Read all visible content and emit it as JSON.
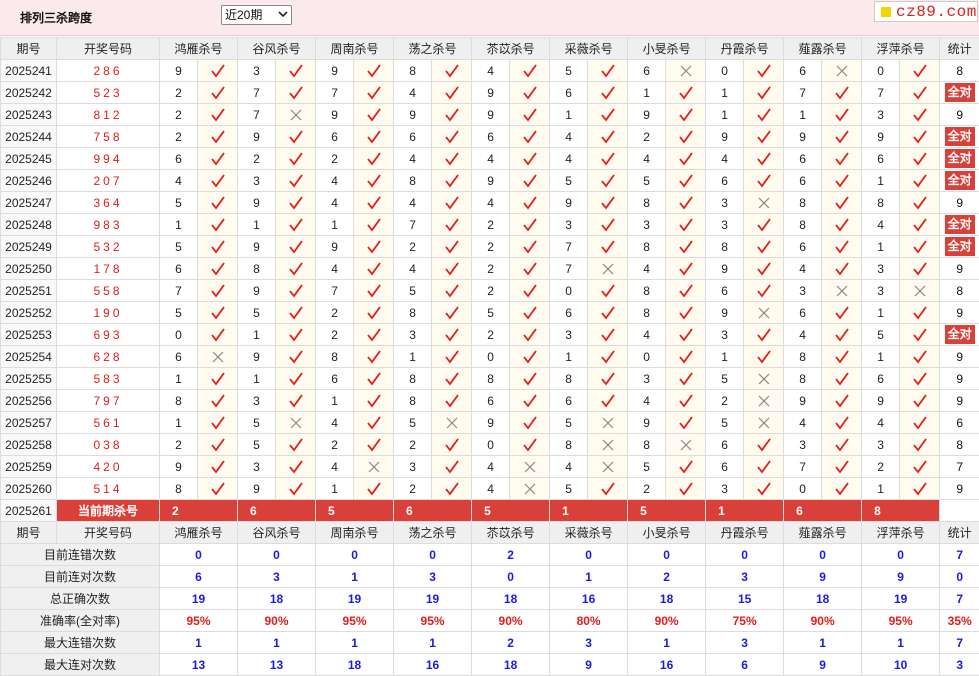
{
  "title": "排列三杀跨度",
  "period_select": {
    "value": "近20期"
  },
  "logo": {
    "text": "cz89.com"
  },
  "headers": {
    "period": "期号",
    "code": "开奖号码",
    "experts": [
      "鸿雁杀号",
      "谷风杀号",
      "周南杀号",
      "荡之杀号",
      "苶苡杀号",
      "采薇杀号",
      "小旻杀号",
      "丹霞杀号",
      "薤露杀号",
      "浮萍杀号"
    ],
    "stat": "统计"
  },
  "rows": [
    {
      "p": "2025241",
      "c": "286",
      "k": [
        "9",
        "3",
        "9",
        "8",
        "4",
        "5",
        "6",
        "0",
        "6",
        "0"
      ],
      "m": [
        1,
        1,
        1,
        1,
        1,
        1,
        0,
        1,
        0,
        1
      ],
      "s": "8"
    },
    {
      "p": "2025242",
      "c": "523",
      "k": [
        "2",
        "7",
        "7",
        "4",
        "9",
        "6",
        "1",
        "1",
        "7",
        "7"
      ],
      "m": [
        1,
        1,
        1,
        1,
        1,
        1,
        1,
        1,
        1,
        1
      ],
      "s": "全对"
    },
    {
      "p": "2025243",
      "c": "812",
      "k": [
        "2",
        "7",
        "9",
        "9",
        "9",
        "1",
        "9",
        "1",
        "1",
        "3"
      ],
      "m": [
        1,
        0,
        1,
        1,
        1,
        1,
        1,
        1,
        1,
        1
      ],
      "s": "9"
    },
    {
      "p": "2025244",
      "c": "758",
      "k": [
        "2",
        "9",
        "6",
        "6",
        "6",
        "4",
        "2",
        "9",
        "9",
        "9"
      ],
      "m": [
        1,
        1,
        1,
        1,
        1,
        1,
        1,
        1,
        1,
        1
      ],
      "s": "全对"
    },
    {
      "p": "2025245",
      "c": "994",
      "k": [
        "6",
        "2",
        "2",
        "4",
        "4",
        "4",
        "4",
        "4",
        "6",
        "6"
      ],
      "m": [
        1,
        1,
        1,
        1,
        1,
        1,
        1,
        1,
        1,
        1
      ],
      "s": "全对"
    },
    {
      "p": "2025246",
      "c": "207",
      "k": [
        "4",
        "3",
        "4",
        "8",
        "9",
        "5",
        "5",
        "6",
        "6",
        "1"
      ],
      "m": [
        1,
        1,
        1,
        1,
        1,
        1,
        1,
        1,
        1,
        1
      ],
      "s": "全对"
    },
    {
      "p": "2025247",
      "c": "364",
      "k": [
        "5",
        "9",
        "4",
        "4",
        "4",
        "9",
        "8",
        "3",
        "8",
        "8"
      ],
      "m": [
        1,
        1,
        1,
        1,
        1,
        1,
        1,
        0,
        1,
        1
      ],
      "s": "9"
    },
    {
      "p": "2025248",
      "c": "983",
      "k": [
        "1",
        "1",
        "1",
        "7",
        "2",
        "3",
        "3",
        "3",
        "8",
        "4"
      ],
      "m": [
        1,
        1,
        1,
        1,
        1,
        1,
        1,
        1,
        1,
        1
      ],
      "s": "全对"
    },
    {
      "p": "2025249",
      "c": "532",
      "k": [
        "5",
        "9",
        "9",
        "2",
        "2",
        "7",
        "8",
        "8",
        "6",
        "1"
      ],
      "m": [
        1,
        1,
        1,
        1,
        1,
        1,
        1,
        1,
        1,
        1
      ],
      "s": "全对"
    },
    {
      "p": "2025250",
      "c": "178",
      "k": [
        "6",
        "8",
        "4",
        "4",
        "2",
        "7",
        "4",
        "9",
        "4",
        "3"
      ],
      "m": [
        1,
        1,
        1,
        1,
        1,
        0,
        1,
        1,
        1,
        1
      ],
      "s": "9"
    },
    {
      "p": "2025251",
      "c": "558",
      "k": [
        "7",
        "9",
        "7",
        "5",
        "2",
        "0",
        "8",
        "6",
        "3",
        "3"
      ],
      "m": [
        1,
        1,
        1,
        1,
        1,
        1,
        1,
        1,
        0,
        0
      ],
      "s": "8"
    },
    {
      "p": "2025252",
      "c": "190",
      "k": [
        "5",
        "5",
        "2",
        "8",
        "5",
        "6",
        "8",
        "9",
        "6",
        "1"
      ],
      "m": [
        1,
        1,
        1,
        1,
        1,
        1,
        1,
        0,
        1,
        1
      ],
      "s": "9"
    },
    {
      "p": "2025253",
      "c": "693",
      "k": [
        "0",
        "1",
        "2",
        "3",
        "2",
        "3",
        "4",
        "3",
        "4",
        "5"
      ],
      "m": [
        1,
        1,
        1,
        1,
        1,
        1,
        1,
        1,
        1,
        1
      ],
      "s": "全对"
    },
    {
      "p": "2025254",
      "c": "628",
      "k": [
        "6",
        "9",
        "8",
        "1",
        "0",
        "1",
        "0",
        "1",
        "8",
        "1"
      ],
      "m": [
        0,
        1,
        1,
        1,
        1,
        1,
        1,
        1,
        1,
        1
      ],
      "s": "9"
    },
    {
      "p": "2025255",
      "c": "583",
      "k": [
        "1",
        "1",
        "6",
        "8",
        "8",
        "8",
        "3",
        "5",
        "8",
        "6"
      ],
      "m": [
        1,
        1,
        1,
        1,
        1,
        1,
        1,
        0,
        1,
        1
      ],
      "s": "9"
    },
    {
      "p": "2025256",
      "c": "797",
      "k": [
        "8",
        "3",
        "1",
        "8",
        "6",
        "6",
        "4",
        "2",
        "9",
        "9"
      ],
      "m": [
        1,
        1,
        1,
        1,
        1,
        1,
        1,
        0,
        1,
        1
      ],
      "s": "9"
    },
    {
      "p": "2025257",
      "c": "561",
      "k": [
        "1",
        "5",
        "4",
        "5",
        "9",
        "5",
        "9",
        "5",
        "4",
        "4"
      ],
      "m": [
        1,
        0,
        1,
        0,
        1,
        0,
        1,
        0,
        1,
        1
      ],
      "s": "6"
    },
    {
      "p": "2025258",
      "c": "038",
      "k": [
        "2",
        "5",
        "2",
        "2",
        "0",
        "8",
        "8",
        "6",
        "3",
        "3"
      ],
      "m": [
        1,
        1,
        1,
        1,
        1,
        0,
        0,
        1,
        1,
        1
      ],
      "s": "8"
    },
    {
      "p": "2025259",
      "c": "420",
      "k": [
        "9",
        "3",
        "4",
        "3",
        "4",
        "4",
        "5",
        "6",
        "7",
        "2"
      ],
      "m": [
        1,
        1,
        0,
        1,
        0,
        0,
        1,
        1,
        1,
        1
      ],
      "s": "7"
    },
    {
      "p": "2025260",
      "c": "514",
      "k": [
        "8",
        "9",
        "1",
        "2",
        "4",
        "5",
        "2",
        "3",
        "0",
        "1"
      ],
      "m": [
        1,
        1,
        1,
        1,
        0,
        1,
        1,
        1,
        1,
        1
      ],
      "s": "9"
    }
  ],
  "current": {
    "p": "2025261",
    "label": "当前期杀号",
    "k": [
      "2",
      "6",
      "5",
      "6",
      "5",
      "1",
      "5",
      "1",
      "6",
      "8"
    ]
  },
  "stats": [
    {
      "label": "目前连错次数",
      "v": [
        "0",
        "0",
        "0",
        "0",
        "2",
        "0",
        "0",
        "0",
        "0",
        "0"
      ],
      "s": "7"
    },
    {
      "label": "目前连对次数",
      "v": [
        "6",
        "3",
        "1",
        "3",
        "0",
        "1",
        "2",
        "3",
        "9",
        "9"
      ],
      "s": "0"
    },
    {
      "label": "总正确次数",
      "v": [
        "19",
        "18",
        "19",
        "19",
        "18",
        "16",
        "18",
        "15",
        "18",
        "19"
      ],
      "s": "7"
    },
    {
      "label": "准确率(全对率)",
      "v": [
        "95%",
        "90%",
        "95%",
        "95%",
        "90%",
        "80%",
        "90%",
        "75%",
        "90%",
        "95%"
      ],
      "s": "35%",
      "accent": true
    },
    {
      "label": "最大连错次数",
      "v": [
        "1",
        "1",
        "1",
        "1",
        "2",
        "3",
        "1",
        "3",
        "1",
        "1"
      ],
      "s": "7"
    },
    {
      "label": "最大连对次数",
      "v": [
        "13",
        "13",
        "18",
        "16",
        "18",
        "9",
        "16",
        "6",
        "9",
        "10"
      ],
      "s": "3"
    }
  ],
  "icons": {
    "correct": "check-icon",
    "wrong": "cross-icon",
    "dropdown": "chevron-down-icon"
  },
  "colors": {
    "accent": "#d9403a",
    "code": "#e31b1b",
    "stat_blue": "#1a1ae0",
    "header_bg": "#fbe9ec"
  }
}
